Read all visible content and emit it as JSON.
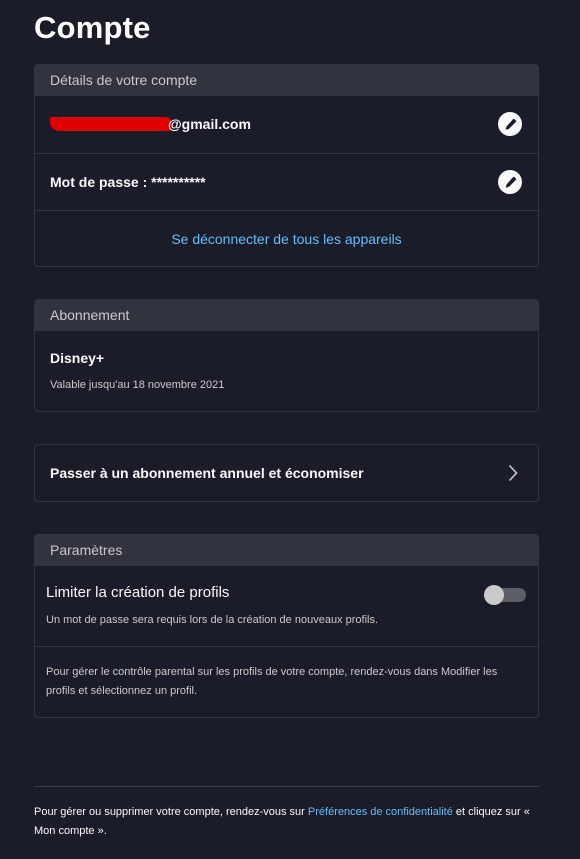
{
  "page": {
    "title": "Compte"
  },
  "account": {
    "header": "Détails de votre compte",
    "email_suffix": "@gmail.com",
    "password_label": "Mot de passe : **********",
    "logout_all": "Se déconnecter de tous les appareils"
  },
  "subscription": {
    "header": "Abonnement",
    "plan": "Disney+",
    "valid_until": "Valable jusqu'au 18 novembre 2021"
  },
  "upgrade": {
    "label": "Passer à un abonnement annuel et économiser"
  },
  "settings": {
    "header": "Paramètres",
    "limit_title": "Limiter la création de profils",
    "limit_desc": "Un mot de passe sera requis lors de la création de nouveaux profils.",
    "limit_enabled": false,
    "parental_text": "Pour gérer le contrôle parental sur les profils de votre compte, rendez-vous dans Modifier les profils et sélectionnez un profil."
  },
  "footer": {
    "text_before": "Pour gérer ou supprimer votre compte, rendez-vous sur ",
    "link": "Préférences de confidentialité",
    "text_after": " et cliquez sur « Mon compte »."
  },
  "colors": {
    "background": "#1a1d29",
    "header_bg": "#31343e",
    "link": "#67bdf6",
    "redaction": "#e00000"
  },
  "icons": {
    "edit": "pencil-icon",
    "chevron": "chevron-right-icon"
  }
}
